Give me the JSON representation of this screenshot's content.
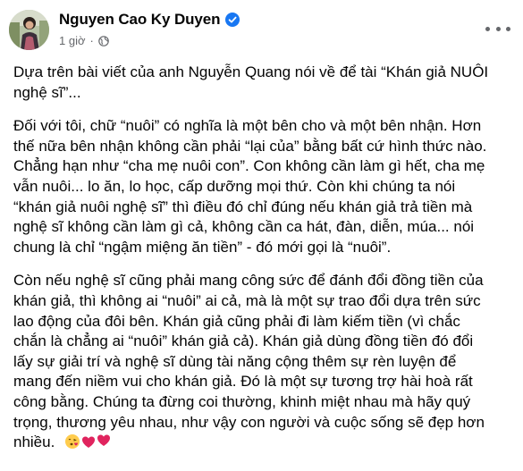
{
  "post": {
    "author": "Nguyen Cao Ky Duyen",
    "time": "1 giờ",
    "separator": "·",
    "paragraphs": [
      "Dựa trên bài viết của anh Nguyễn Quang nói về để tài “Khán giả NUÔI\nnghệ sĩ”...",
      "Đối với tôi, chữ “nuôi” có nghĩa là một bên cho và một bên nhận.  Hơn\nthế nữa bên nhận không cần phải “lại của” bằng bất cứ hình thức nào.\nChẳng hạn như “cha mẹ nuôi con”.  Con không cần làm gì hết, cha mẹ\nvẫn nuôi... lo ăn, lo học, cấp dưỡng mọi thứ.  Còn khi chúng ta nói\n“khán giả nuôi nghệ sĩ” thì điều đó chỉ đúng nếu khán giả trả tiền mà\nnghệ sĩ không cần làm gì cả, không cần ca hát, đàn, diễn, múa... nói\nchung là chỉ “ngậm miệng ăn tiền” - đó mới gọi là “nuôi”.",
      "Còn nếu nghệ sĩ cũng phải mang công sức để đánh đổi đồng tiền của\nkhán giả, thì không ai “nuôi” ai cả, mà là một sự trao đổi dựa trên sức\nlao động của đôi bên.  Khán giả cũng phải đi làm kiếm tiền (vì chắc\nchắn là chẳng ai “nuôi” khán giả cả).  Khán giả dùng đồng tiền đó đổi\nlấy sự giải trí và nghệ sĩ dùng tài năng cộng thêm sự rèn luyện để\nmang đến niềm vui cho khán giả.  Đó là một sự tương trợ hài hoà rất\ncông bằng.  Chúng ta đừng coi thường, khinh miệt nhau mà hãy quý\ntrọng, thương yêu nhau, như vậy con người và cuộc sống sẽ đẹp hơn\nnhiều."
    ],
    "end_emojis": [
      "face-blowing-kiss-emoji",
      "heart-emoji",
      "heart-emoji"
    ]
  },
  "colors": {
    "text": "#050505",
    "secondary": "#65676b",
    "verified": "#1877f2",
    "heart": "#e0245e"
  }
}
